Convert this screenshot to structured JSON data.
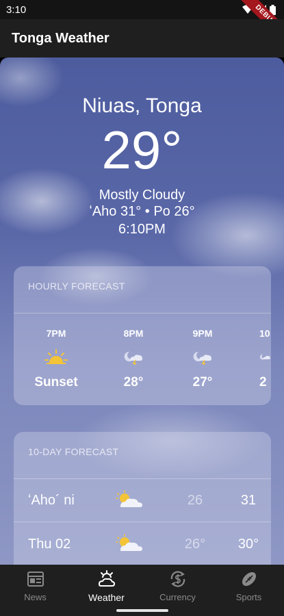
{
  "status_bar": {
    "time": "3:10",
    "debug_label": "DEBUG"
  },
  "app_bar": {
    "title": "Tonga Weather"
  },
  "current": {
    "location": "Niuas, Tonga",
    "temperature": "29°",
    "condition": "Mostly Cloudy",
    "high_low": "ʻAho 31° • Po 26°",
    "time": "6:10PM"
  },
  "hourly": {
    "title": "HOURLY FORECAST",
    "items": [
      {
        "time": "7PM",
        "icon": "sunset-icon",
        "value": "Sunset"
      },
      {
        "time": "8PM",
        "icon": "night-storm-icon",
        "value": "28°"
      },
      {
        "time": "9PM",
        "icon": "night-storm-icon",
        "value": "27°"
      },
      {
        "time": "10",
        "icon": "night-storm-icon",
        "value": "2"
      }
    ]
  },
  "daily": {
    "title": "10-DAY FORECAST",
    "items": [
      {
        "day": "ʻAho´ ni",
        "icon": "partly-cloudy-icon",
        "low": "26",
        "high": "31"
      },
      {
        "day": "Thu 02",
        "icon": "partly-cloudy-icon",
        "low": "26°",
        "high": "30°"
      }
    ]
  },
  "nav": {
    "items": [
      {
        "label": "News",
        "icon": "news-icon",
        "active": false
      },
      {
        "label": "Weather",
        "icon": "weather-icon",
        "active": true
      },
      {
        "label": "Currency",
        "icon": "currency-icon",
        "active": false
      },
      {
        "label": "Sports",
        "icon": "sports-icon",
        "active": false
      }
    ]
  },
  "colors": {
    "status_bar": "#141414",
    "app_bar": "#1f1f1f",
    "sky": "#5a68a8",
    "sun": "#f3c437",
    "debug": "#a3171d"
  }
}
